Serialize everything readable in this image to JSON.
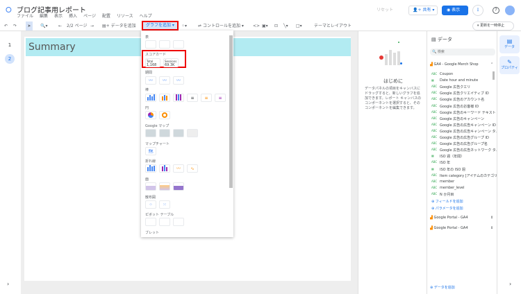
{
  "app": {
    "title": "ブログ記事用レポート",
    "menu": [
      "ファイル",
      "編集",
      "表示",
      "挿入",
      "ページ",
      "配置",
      "リソース",
      "ヘルプ"
    ]
  },
  "header": {
    "reset": "リセット",
    "share": "共有",
    "view": "表示",
    "more": "⋮",
    "help": "?",
    "pause": "更新を一時停止"
  },
  "toolbar": {
    "undo": "↶",
    "redo": "↷",
    "zoom": "🔍▾",
    "page_nav": "2/2 ページ",
    "add_data": "データを追加",
    "add_chart": "グラフを追加",
    "add_control": "コントロールを追加",
    "code": "<>",
    "theme": "テーマとレイアウト"
  },
  "pages": [
    "1",
    "2"
  ],
  "canvas": {
    "header_text": "Summary"
  },
  "chart_menu": {
    "sections": [
      "表",
      "スコアカード",
      "期間",
      "棒",
      "円",
      "Google マップ",
      "マップチャート",
      "折れ線",
      "面",
      "散布図",
      "ピボット テーブル",
      "ブレット"
    ],
    "scorecard": [
      {
        "label": "Total",
        "value": "1,168"
      },
      {
        "label": "Sessions",
        "value": "69.3K"
      }
    ]
  },
  "intro": {
    "title": "はじめに",
    "body": "データパネルの項目をキャンバスにドラッグすると、新しいグラフを追加できます。レポート キャンバスのコンポーネントを選択すると、そのコンポーネントを編集できます。"
  },
  "data_panel": {
    "title": "データ",
    "search_placeholder": "検索",
    "source": "GA4 - Google Merch Shop",
    "fields": [
      "Coupon",
      "Date hour and minute",
      "Google 広告クエリ",
      "Google 広告クリエイティブ ID",
      "Google 広告のアカウント名",
      "Google 広告のお客様 ID",
      "Google 広告のキーワード テキスト",
      "Google 広告のキャンペーン",
      "Google 広告の広告キャンペーン ID",
      "Google 広告の広告キャンペーン タ...",
      "Google 広告の広告グループ ID",
      "Google 広告の広告グループ名",
      "Google 広告の広告ネットワーク タ...",
      "ISO 週（年間）",
      "ISO 年",
      "ISO 年の ISO 週",
      "Item category [アイテムのカテゴリ]",
      "member",
      "member_level",
      "N か月目"
    ],
    "add_field": "フィールドを追加",
    "add_param": "パラメータを追加",
    "other_sources": [
      "Google Portal - GA4",
      "Google Portal - GA4"
    ],
    "add_data": "データを追加"
  },
  "right_rail": {
    "data": "データ",
    "properties": "プロパティ"
  },
  "colors": {
    "accent": "#1a73e8",
    "header_band": "#b2ebf2",
    "highlight": "#ee0000"
  }
}
